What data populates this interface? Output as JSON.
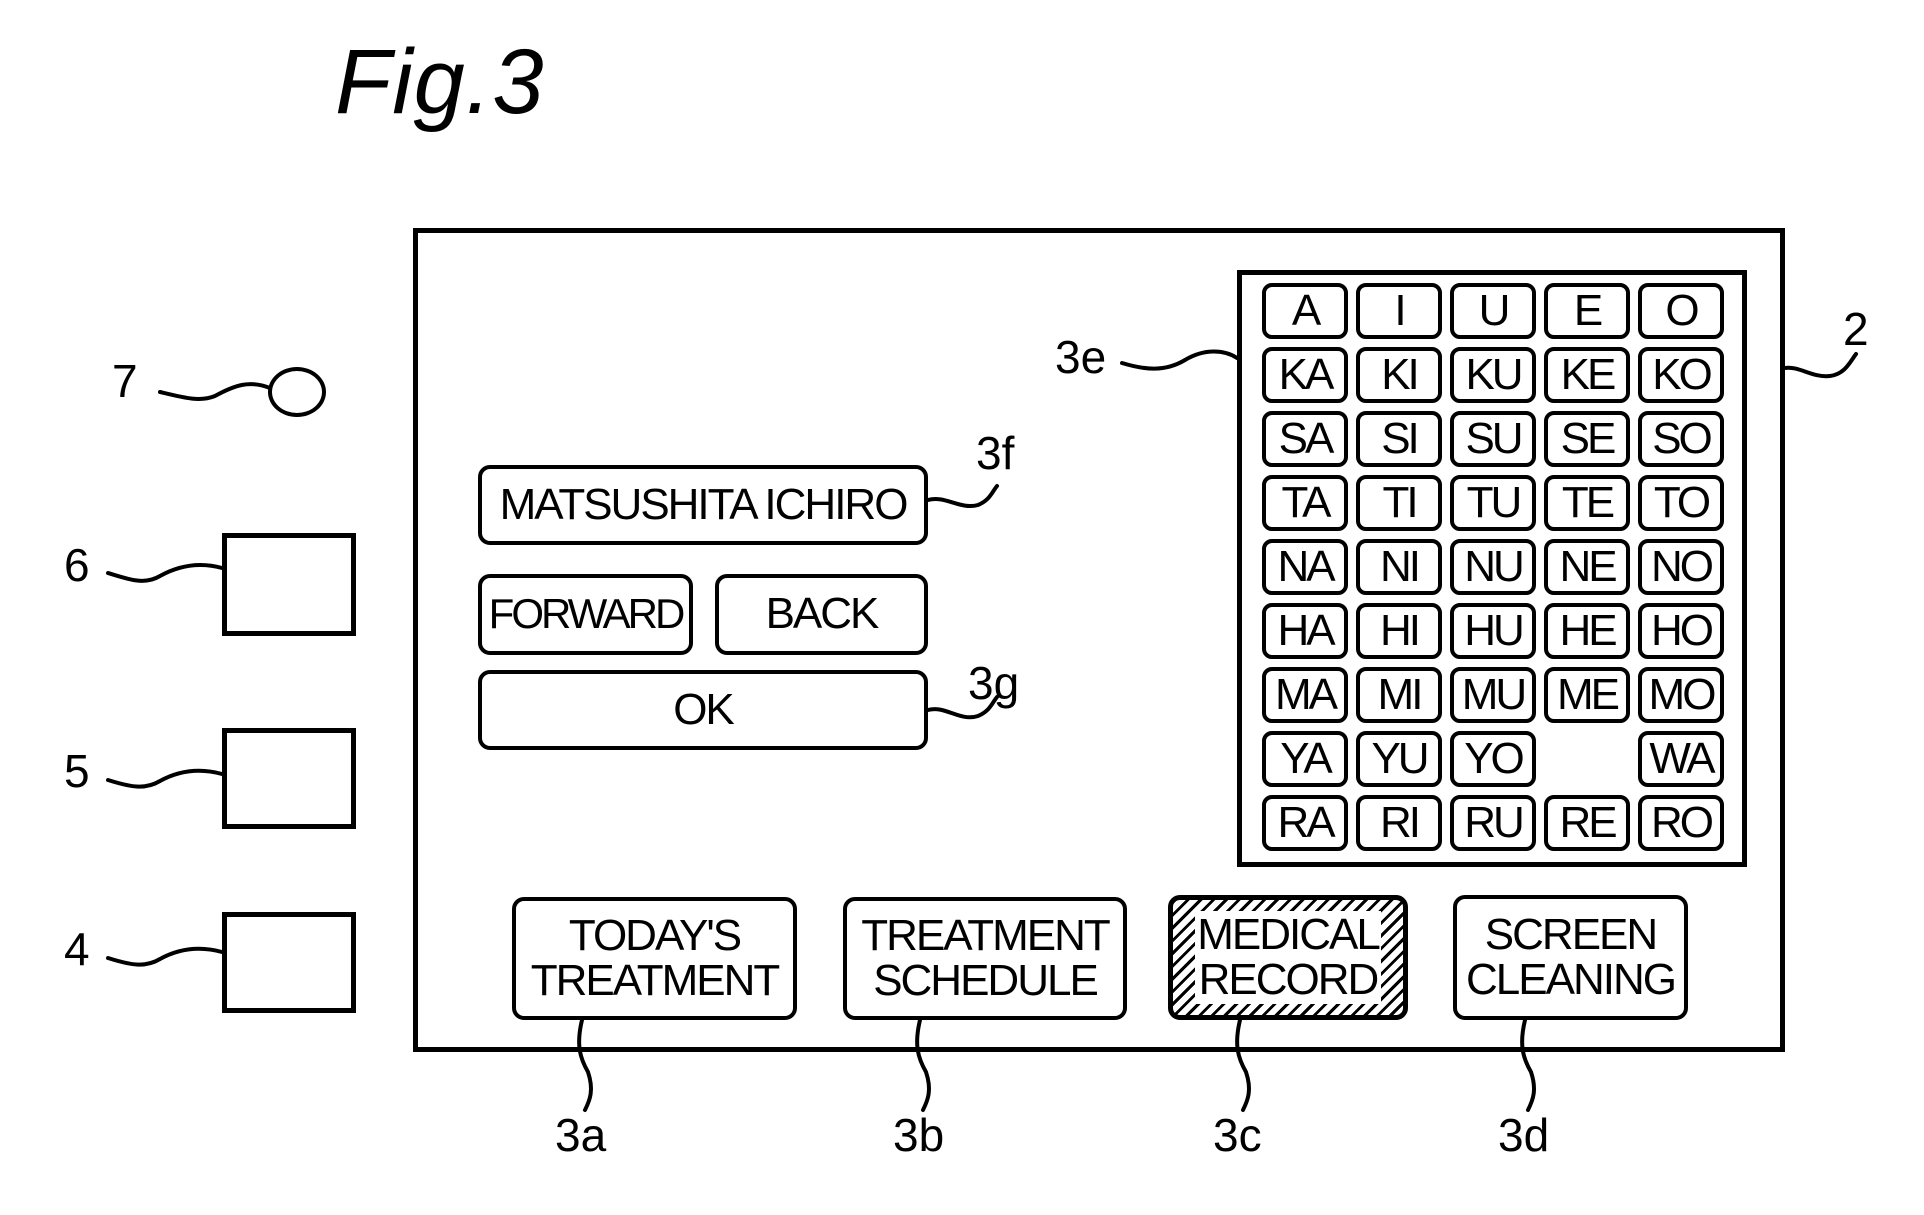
{
  "figure": {
    "title": "Fig.3"
  },
  "reference_labels": {
    "screen": "2",
    "button_todays_treatment": "3a",
    "button_treatment_schedule": "3b",
    "button_medical_record": "3c",
    "button_screen_cleaning": "3d",
    "keypad": "3e",
    "name_field": "3f",
    "ok_button": "3g",
    "device_4": "4",
    "device_5": "5",
    "device_6": "6",
    "lamp_7": "7"
  },
  "name_entry": {
    "value": "MATSUSHITA ICHIRO",
    "forward_label": "FORWARD",
    "back_label": "BACK",
    "ok_label": "OK"
  },
  "keypad": {
    "rows": [
      [
        "A",
        "I",
        "U",
        "E",
        "O"
      ],
      [
        "KA",
        "KI",
        "KU",
        "KE",
        "KO"
      ],
      [
        "SA",
        "SI",
        "SU",
        "SE",
        "SO"
      ],
      [
        "TA",
        "TI",
        "TU",
        "TE",
        "TO"
      ],
      [
        "NA",
        "NI",
        "NU",
        "NE",
        "NO"
      ],
      [
        "HA",
        "HI",
        "HU",
        "HE",
        "HO"
      ],
      [
        "MA",
        "MI",
        "MU",
        "ME",
        "MO"
      ],
      [
        "YA",
        "YU",
        "YO",
        "",
        "WA"
      ],
      [
        "RA",
        "RI",
        "RU",
        "RE",
        "RO"
      ]
    ]
  },
  "menu_buttons": [
    {
      "line1": "TODAY'S",
      "line2": "TREATMENT",
      "selected": false
    },
    {
      "line1": "TREATMENT",
      "line2": "SCHEDULE",
      "selected": false
    },
    {
      "line1": "MEDICAL",
      "line2": "RECORD",
      "selected": true
    },
    {
      "line1": "SCREEN",
      "line2": "CLEANING",
      "selected": false
    }
  ]
}
